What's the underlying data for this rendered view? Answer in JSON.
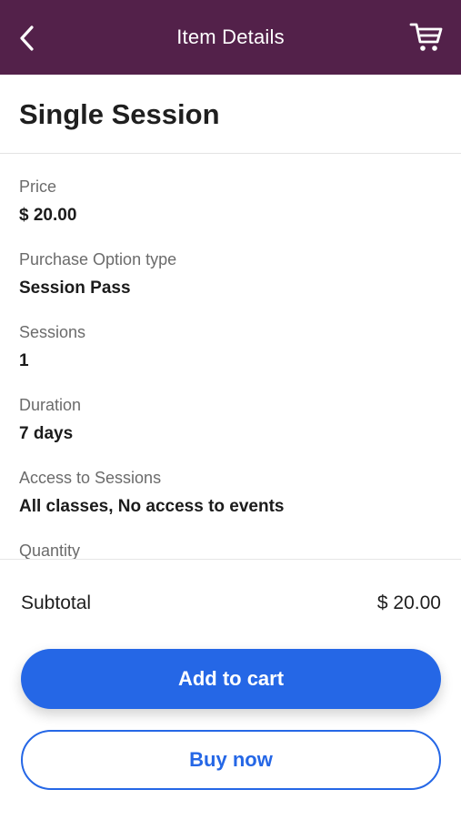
{
  "app_bar": {
    "title": "Item Details",
    "back_icon": "chevron-left-icon",
    "cart_icon": "shopping-cart-icon",
    "background": "#53214a"
  },
  "item": {
    "name": "Single Session"
  },
  "fields": [
    {
      "label": "Price",
      "value": "$ 20.00"
    },
    {
      "label": "Purchase Option type",
      "value": "Session Pass"
    },
    {
      "label": "Sessions",
      "value": "1"
    },
    {
      "label": "Duration",
      "value": "7 days"
    },
    {
      "label": "Access to Sessions",
      "value": "All classes, No access to events"
    },
    {
      "label": "Quantity",
      "value": ""
    }
  ],
  "footer": {
    "subtotal_label": "Subtotal",
    "subtotal_value": "$ 20.00",
    "add_to_cart_label": "Add to cart",
    "buy_now_label": "Buy now",
    "accent_color": "#2567e6"
  }
}
